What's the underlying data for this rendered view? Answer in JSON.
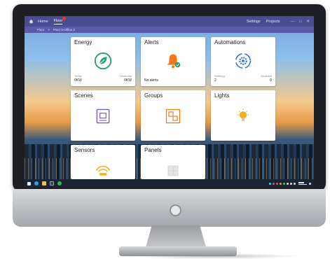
{
  "nav": {
    "home": "Home",
    "floor": "Floor",
    "settings": "Settings",
    "projects": "Projects"
  },
  "breadcrumb": {
    "root": "Floor",
    "separator": ">",
    "current": "Floor 5-Office 2"
  },
  "cards": {
    "energy": {
      "title": "Energy",
      "today_label": "Today",
      "today_value": "0KW",
      "yesterday_label": "Yesterday",
      "yesterday_value": "0KW"
    },
    "alerts": {
      "title": "Alerts",
      "status": "No alerts"
    },
    "automations": {
      "title": "Automations",
      "working_label": "Working",
      "working_value": "2",
      "disabled_label": "Disabled",
      "disabled_value": "0"
    },
    "scenes": {
      "title": "Scenes"
    },
    "groups": {
      "title": "Groups"
    },
    "lights": {
      "title": "Lights"
    },
    "sensors": {
      "title": "Sensors"
    },
    "panels": {
      "title": "Panels"
    }
  },
  "colors": {
    "titlebar": "#4b4c93",
    "accent_green": "#2f9e6a",
    "accent_orange": "#f07a1a",
    "accent_blue": "#2f6fd8",
    "accent_purple": "#7b5cc7",
    "accent_yellow": "#f2b21b"
  }
}
